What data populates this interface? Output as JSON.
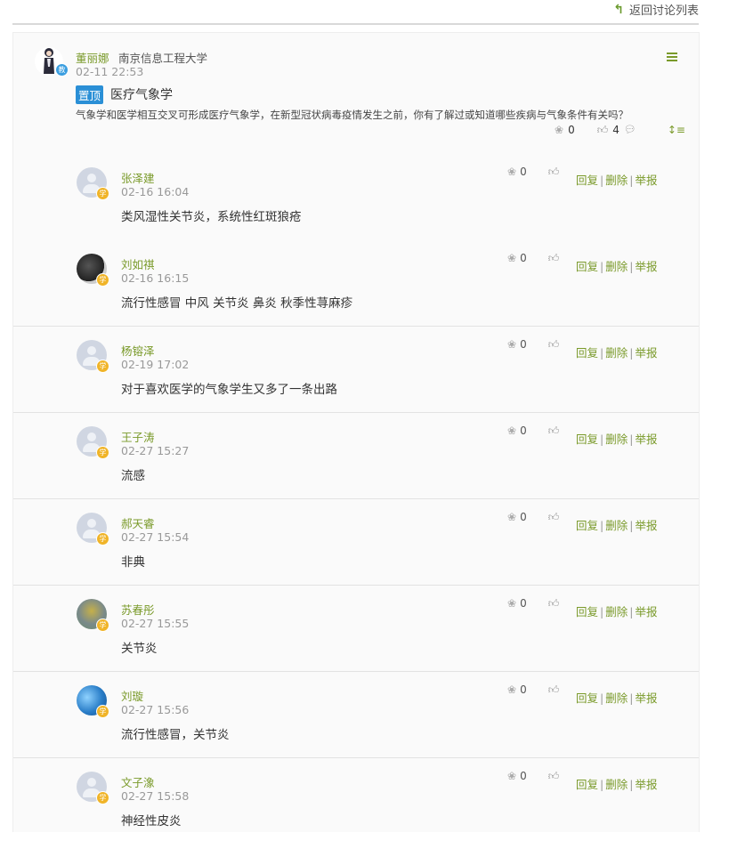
{
  "header": {
    "back_label": "返回讨论列表"
  },
  "post": {
    "author": "董丽娜",
    "school": "南京信息工程大学",
    "role_badge": "教",
    "time": "02-11 22:53",
    "pin_label": "置顶",
    "title": "医疗气象学",
    "body": "气象学和医学相互交叉可形成医疗气象学，在新型冠状病毒疫情发生之前，你有了解过或知道哪些疾病与气象条件有关吗？",
    "flower_count": "0",
    "like_count": "4"
  },
  "reply_actions": {
    "reply": "回复",
    "delete": "删除",
    "report": "举报"
  },
  "replies": [
    {
      "name": "张泽建",
      "time": "02-16 16:04",
      "text": "类风湿性关节炎，系统性红斑狼疮",
      "badge": "学",
      "flower_count": "0"
    },
    {
      "name": "刘如祺",
      "time": "02-16 16:15",
      "text": "流行性感冒 中风 关节炎 鼻炎 秋季性荨麻疹",
      "badge": "学",
      "flower_count": "0"
    },
    {
      "name": "杨镕泽",
      "time": "02-19 17:02",
      "text": "对于喜欢医学的气象学生又多了一条出路",
      "badge": "学",
      "flower_count": "0"
    },
    {
      "name": "王子涛",
      "time": "02-27 15:27",
      "text": "流感",
      "badge": "学",
      "flower_count": "0"
    },
    {
      "name": "郝天睿",
      "time": "02-27 15:54",
      "text": "非典",
      "badge": "学",
      "flower_count": "0"
    },
    {
      "name": "苏春彤",
      "time": "02-27 15:55",
      "text": "关节炎",
      "badge": "学",
      "flower_count": "0"
    },
    {
      "name": "刘璇",
      "time": "02-27 15:56",
      "text": "流行性感冒，关节炎",
      "badge": "学",
      "flower_count": "0"
    },
    {
      "name": "文子潒",
      "time": "02-27 15:58",
      "text": "神经性皮炎",
      "badge": "学",
      "flower_count": "0"
    }
  ],
  "icons": {
    "back": "return-arrow-icon",
    "menu": "hamburger-menu-icon",
    "flower": "flower-icon",
    "like": "thumbs-up-icon",
    "comment": "comment-icon",
    "sort": "sort-icon"
  },
  "colors": {
    "accent_green": "#7a9a2a",
    "pin_blue": "#2a8fd6",
    "student_badge": "#f0b428",
    "teacher_badge": "#3a9ee0"
  }
}
